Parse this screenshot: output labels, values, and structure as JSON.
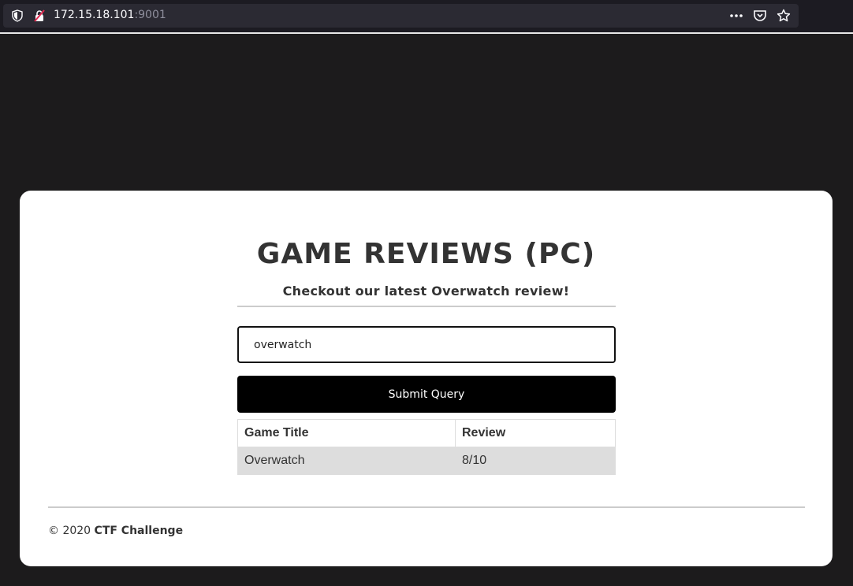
{
  "browser": {
    "url_host": "172.15.18.101",
    "url_port": ":9001",
    "icons": [
      "shield-icon",
      "insecure-lock-icon",
      "more-icon",
      "pocket-icon",
      "bookmark-star-icon"
    ]
  },
  "page": {
    "title": "GAME REVIEWS (PC)",
    "subtitle": "Checkout our latest Overwatch review!",
    "search": {
      "value": "overwatch",
      "placeholder": ""
    },
    "submit_label": "Submit Query",
    "table": {
      "headers": [
        "Game Title",
        "Review"
      ],
      "rows": [
        [
          "Overwatch",
          "8/10"
        ]
      ]
    },
    "footer": {
      "copyright": "© 2020",
      "owner": "CTF Challenge"
    }
  },
  "colors": {
    "background": "#1c1b1c",
    "card": "#ffffff",
    "button": "#000000",
    "row_highlight": "#dddddd"
  }
}
